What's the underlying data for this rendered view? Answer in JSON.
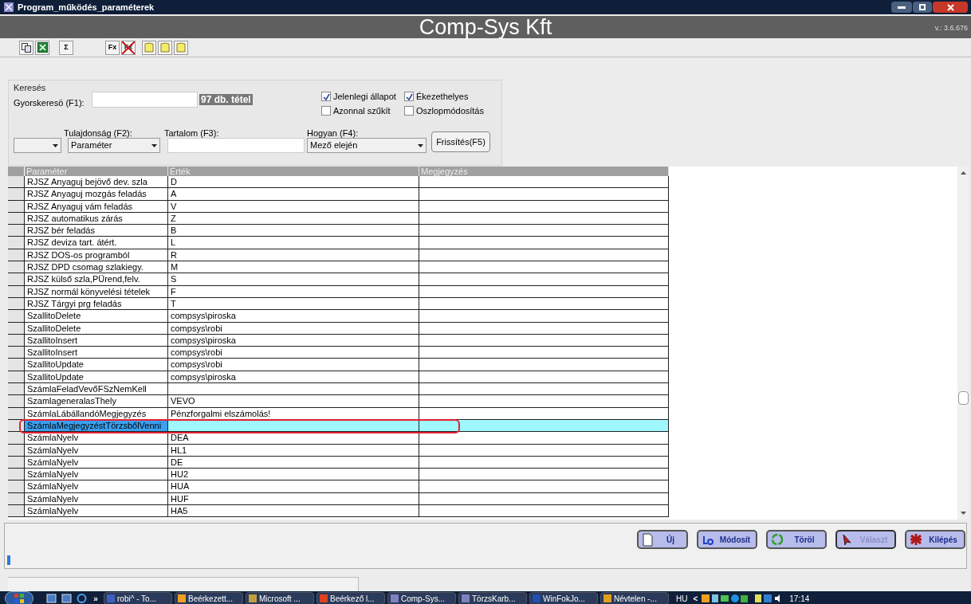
{
  "window": {
    "title": "Program_működés_paraméterek"
  },
  "header": {
    "title": "Comp-Sys Kft",
    "version": "v.: 3.6.676"
  },
  "toolbar": [
    {
      "kind": "copy"
    },
    {
      "kind": "excel"
    },
    {
      "kind": "sum",
      "label": "Σ"
    },
    {
      "kind": "fx",
      "label": "Fx"
    },
    {
      "kind": "fx-off",
      "label": "Fx"
    },
    {
      "kind": "note"
    },
    {
      "kind": "note"
    },
    {
      "kind": "note"
    }
  ],
  "search": {
    "group_title": "Keresés",
    "quick_label": "Gyorskeresö (F1):",
    "count": "97 db. tétel",
    "checkboxes": [
      {
        "label": "Jelenlegi állapot",
        "checked": true
      },
      {
        "label": "Ékezethelyes",
        "checked": true
      },
      {
        "label": "Azonnal szűkít",
        "checked": false
      },
      {
        "label": "Oszlopmódosítás",
        "checked": false
      }
    ],
    "property_label": "Tulajdonság (F2):",
    "property_value": "Paraméter",
    "content_label": "Tartalom (F3):",
    "how_label": "Hogyan (F4):",
    "how_value": "Mező elején",
    "refresh": "Frissítés(F5)"
  },
  "table": {
    "columns": [
      "Paraméter",
      "Érték",
      "Megjegyzés"
    ],
    "rows": [
      {
        "cells": [
          "RJSZ Anyaguj bejövő dev. szla",
          "D"
        ],
        "selected": false
      },
      {
        "cells": [
          "RJSZ Anyaguj mozgás feladás",
          "A"
        ],
        "selected": false
      },
      {
        "cells": [
          "RJSZ Anyaguj vám feladás",
          "V"
        ],
        "selected": false
      },
      {
        "cells": [
          "RJSZ automatikus zárás",
          "Z"
        ],
        "selected": false
      },
      {
        "cells": [
          "RJSZ bér feladás",
          "B"
        ],
        "selected": false
      },
      {
        "cells": [
          "RJSZ deviza tart. átért.",
          "L"
        ],
        "selected": false
      },
      {
        "cells": [
          "RJSZ DOS-os programból",
          "R"
        ],
        "selected": false
      },
      {
        "cells": [
          "RJSZ DPD csomag szlakiegy.",
          "M"
        ],
        "selected": false
      },
      {
        "cells": [
          "RJSZ külső szla,PÜrend,felv.",
          "S"
        ],
        "selected": false
      },
      {
        "cells": [
          "RJSZ normál könyvelési tételek",
          "F"
        ],
        "selected": false
      },
      {
        "cells": [
          "RJSZ Tárgyi prg feladás",
          "T"
        ],
        "selected": false
      },
      {
        "cells": [
          "SzallitoDelete",
          "compsys\\piroska"
        ],
        "selected": false
      },
      {
        "cells": [
          "SzallitoDelete",
          "compsys\\robi"
        ],
        "selected": false
      },
      {
        "cells": [
          "SzallitoInsert",
          "compsys\\piroska"
        ],
        "selected": false
      },
      {
        "cells": [
          "SzallitoInsert",
          "compsys\\robi"
        ],
        "selected": false
      },
      {
        "cells": [
          "SzallitoUpdate",
          "compsys\\robi"
        ],
        "selected": false
      },
      {
        "cells": [
          "SzallitoUpdate",
          "compsys\\piroska"
        ],
        "selected": false
      },
      {
        "cells": [
          "SzámlaFeladVevőFSzNemKell"
        ],
        "selected": false
      },
      {
        "cells": [
          "SzamlageneralasThely",
          "VEVO"
        ],
        "selected": false
      },
      {
        "cells": [
          "SzámlaLábállandóMegjegyzés",
          "Pénzforgalmi elszámolás!"
        ],
        "selected": false
      },
      {
        "cells": [
          "SzámlaMegjegyzéstTörzsbőlVenni"
        ],
        "selected": true
      },
      {
        "cells": [
          "SzámlaNyelv",
          "DEA"
        ],
        "selected": false
      },
      {
        "cells": [
          "SzámlaNyelv",
          "HL1"
        ],
        "selected": false
      },
      {
        "cells": [
          "SzámlaNyelv",
          "DE"
        ],
        "selected": false
      },
      {
        "cells": [
          "SzámlaNyelv",
          "HU2"
        ],
        "selected": false
      },
      {
        "cells": [
          "SzámlaNyelv",
          "HUA"
        ],
        "selected": false
      },
      {
        "cells": [
          "SzámlaNyelv",
          "HUF"
        ],
        "selected": false
      },
      {
        "cells": [
          "SzámlaNyelv",
          "HA5"
        ],
        "selected": false
      }
    ]
  },
  "buttons": [
    {
      "kind": "new",
      "label": "Új",
      "disabled": false
    },
    {
      "kind": "edit",
      "label": "Módosít",
      "disabled": false
    },
    {
      "kind": "delete",
      "label": "Töröl",
      "disabled": false
    },
    {
      "kind": "choose",
      "label": "Választ",
      "disabled": true
    },
    {
      "kind": "exit",
      "label": "Kilépés",
      "disabled": false
    }
  ],
  "taskbar": {
    "more": "»",
    "items": [
      {
        "label": "robi^ - To...",
        "color": "#4060c0"
      },
      {
        "label": "Beérkezett...",
        "color": "#f0a020"
      },
      {
        "label": "Microsoft ...",
        "color": "#c0a040"
      },
      {
        "label": "Beérkező l...",
        "color": "#e04020"
      },
      {
        "label": "Comp-Sys...",
        "color": "#8080c0"
      },
      {
        "label": "TörzsKarb...",
        "color": "#8080c0"
      },
      {
        "label": "WinFokJo...",
        "color": "#2050b0"
      },
      {
        "label": "Névtelen -...",
        "color": "#e0a020"
      }
    ],
    "language": "HU",
    "tray_toggle": "<",
    "clock": "17:14"
  }
}
